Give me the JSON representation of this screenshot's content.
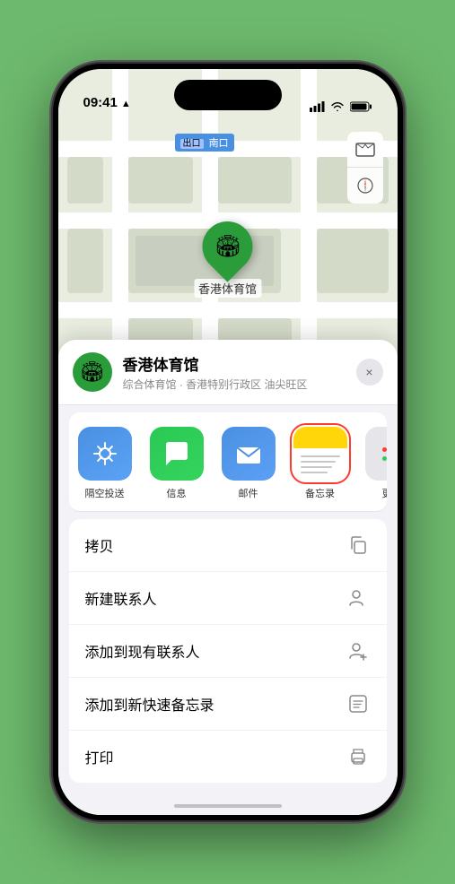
{
  "status_bar": {
    "time": "09:41",
    "location_arrow": "▶"
  },
  "map": {
    "label": "南口",
    "label_prefix": "出口",
    "pin_label": "香港体育馆",
    "pin_emoji": "🏟"
  },
  "map_controls": {
    "map_icon": "🗺",
    "compass_icon": "⊕"
  },
  "location_card": {
    "name": "香港体育馆",
    "subtitle": "综合体育馆 · 香港特别行政区 油尖旺区",
    "icon": "🏟",
    "close_label": "×"
  },
  "share_items": [
    {
      "id": "airdrop",
      "label": "隔空投送",
      "color": "#4a90e2",
      "type": "airdrop"
    },
    {
      "id": "messages",
      "label": "信息",
      "color": "#2ac954",
      "type": "messages"
    },
    {
      "id": "mail",
      "label": "邮件",
      "color": "#4a90e2",
      "type": "mail"
    },
    {
      "id": "notes",
      "label": "备忘录",
      "type": "notes",
      "selected": true
    },
    {
      "id": "more",
      "label": "更多",
      "type": "more"
    }
  ],
  "action_items": [
    {
      "id": "copy",
      "label": "拷贝",
      "icon": "copy"
    },
    {
      "id": "new-contact",
      "label": "新建联系人",
      "icon": "person-add"
    },
    {
      "id": "add-contact",
      "label": "添加到现有联系人",
      "icon": "person-plus"
    },
    {
      "id": "quick-note",
      "label": "添加到新快速备忘录",
      "icon": "note"
    },
    {
      "id": "print",
      "label": "打印",
      "icon": "print"
    }
  ]
}
